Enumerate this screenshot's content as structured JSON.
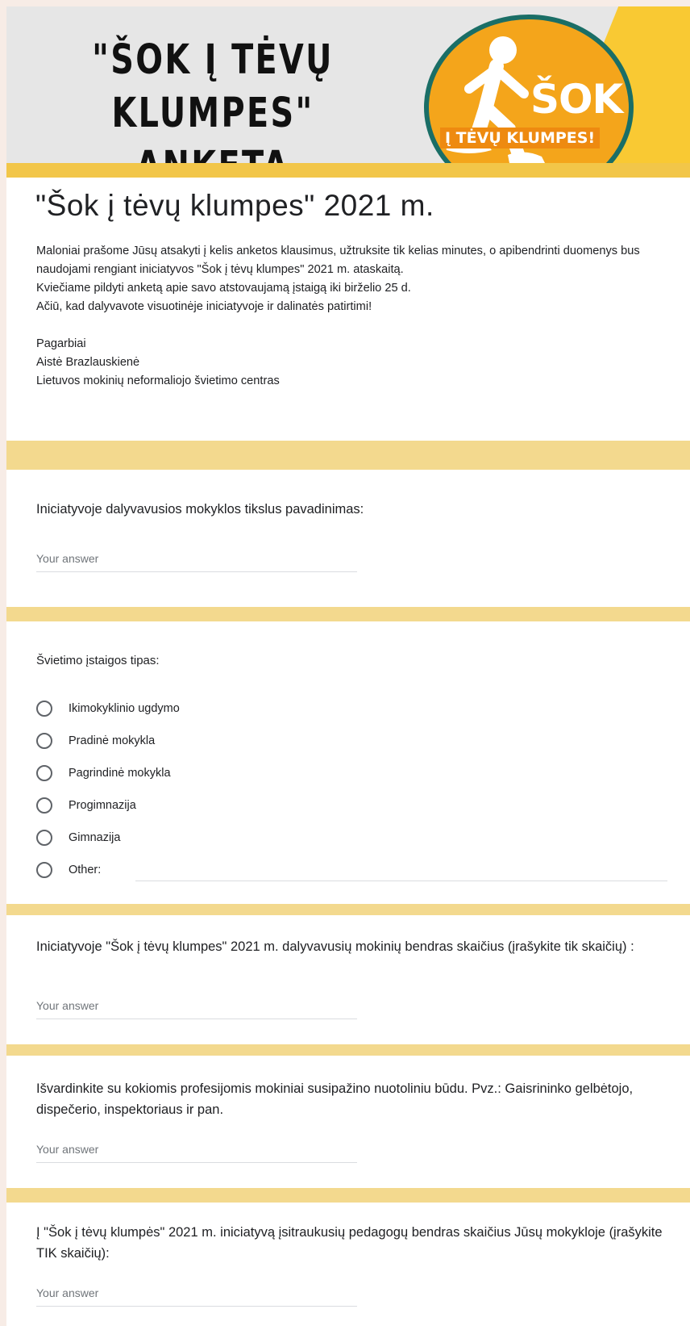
{
  "banner": {
    "title_line1": "\"ŠOK Į TĖVŲ",
    "title_line2": "KLUMPES\" ANKETA",
    "logo_word": "ŠOK",
    "logo_subtitle": "Į TĖVŲ KLUMPES!"
  },
  "form": {
    "title": "\"Šok į tėvų klumpes\" 2021 m.",
    "description": [
      "Maloniai prašome Jūsų atsakyti į kelis anketos klausimus, užtruksite tik kelias minutes, o apibendrinti duomenys bus naudojami rengiant iniciatyvos \"Šok į tėvų klumpes\" 2021 m. ataskaitą.",
      "Kviečiame  pildyti anketą apie savo atstovaujamą  įstaigą  iki birželio 25 d.",
      "Ačiū, kad dalyvavote visuotinėje iniciatyvoje ir dalinatės patirtimi!"
    ],
    "signature": [
      "Pagarbiai",
      "Aistė Brazlauskienė",
      "Lietuvos mokinių neformaliojo švietimo centras"
    ]
  },
  "questions": [
    {
      "label": "Iniciatyvoje dalyvavusios mokyklos tikslus pavadinimas:",
      "placeholder": "Your answer"
    },
    {
      "label": "Švietimo įstaigos tipas:",
      "options": [
        "Ikimokyklinio ugdymo",
        "Pradinė mokykla",
        "Pagrindinė mokykla",
        "Progimnazija",
        "Gimnazija",
        "Other:"
      ]
    },
    {
      "label": "Iniciatyvoje \"Šok į tėvų klumpes\" 2021 m. dalyvavusių mokinių bendras skaičius (įrašykite tik skaičių) :",
      "placeholder": "Your answer"
    },
    {
      "label": "Išvardinkite su kokiomis profesijomis mokiniai susipažino nuotoliniu būdu. Pvz.: Gaisrininko gelbėtojo, dispečerio, inspektoriaus ir pan.",
      "placeholder": "Your answer"
    },
    {
      "label": "Į \"Šok į tėvų klumpės\" 2021 m. iniciatyvą įsitraukusių pedagogų bendras skaičius Jūsų mokykloje (įrašykite TIK skaičių):",
      "placeholder": "Your answer"
    }
  ],
  "colors": {
    "page_bg": "#f7ece6",
    "separator": "#f3d98e",
    "separator_dark": "#f2c649",
    "logo_orange": "#f4a51b",
    "logo_ring": "#1a6e66"
  }
}
